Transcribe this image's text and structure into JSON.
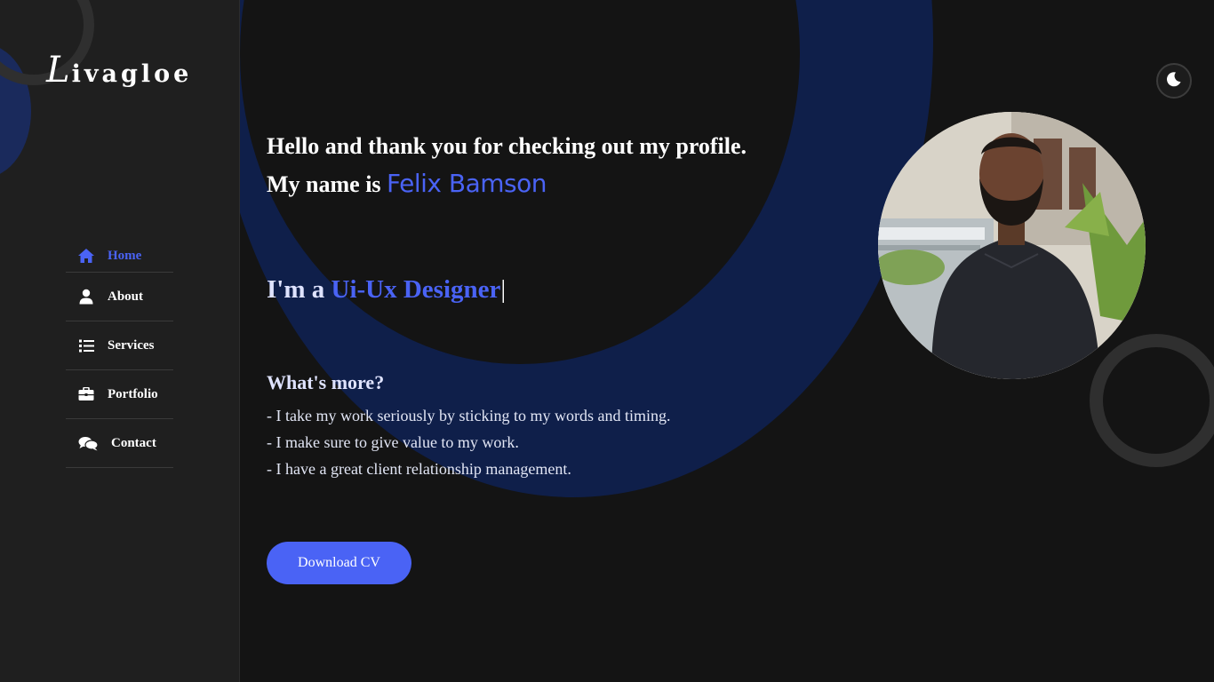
{
  "brand": {
    "logo_cap": "L",
    "logo_rest": "ivagloe"
  },
  "sidebar": {
    "items": [
      {
        "label": "Home",
        "icon": "home-icon",
        "active": true
      },
      {
        "label": "About",
        "icon": "user-icon",
        "active": false
      },
      {
        "label": "Services",
        "icon": "list-icon",
        "active": false
      },
      {
        "label": "Portfolio",
        "icon": "briefcase-icon",
        "active": false
      },
      {
        "label": "Contact",
        "icon": "chat-icon",
        "active": false
      }
    ]
  },
  "hero": {
    "line1": "Hello and thank you for checking out my profile.",
    "line2_prefix": "My name is ",
    "name": "Felix Bamson",
    "role_prefix": "I'm a ",
    "role": "Ui-Ux Designer",
    "caret": "|",
    "more_title": "What's more?",
    "points": [
      "- I take my work seriously by sticking to my words and timing.",
      "- I make sure to give value to my work.",
      "- I have a great client relationship management."
    ],
    "cv_button": "Download CV"
  },
  "theme_toggle": {
    "icon": "moon-icon"
  },
  "colors": {
    "accent": "#4a63f5",
    "background": "#141414",
    "sidebar": "#1f1f1f",
    "ring": "#0f1f4a"
  }
}
